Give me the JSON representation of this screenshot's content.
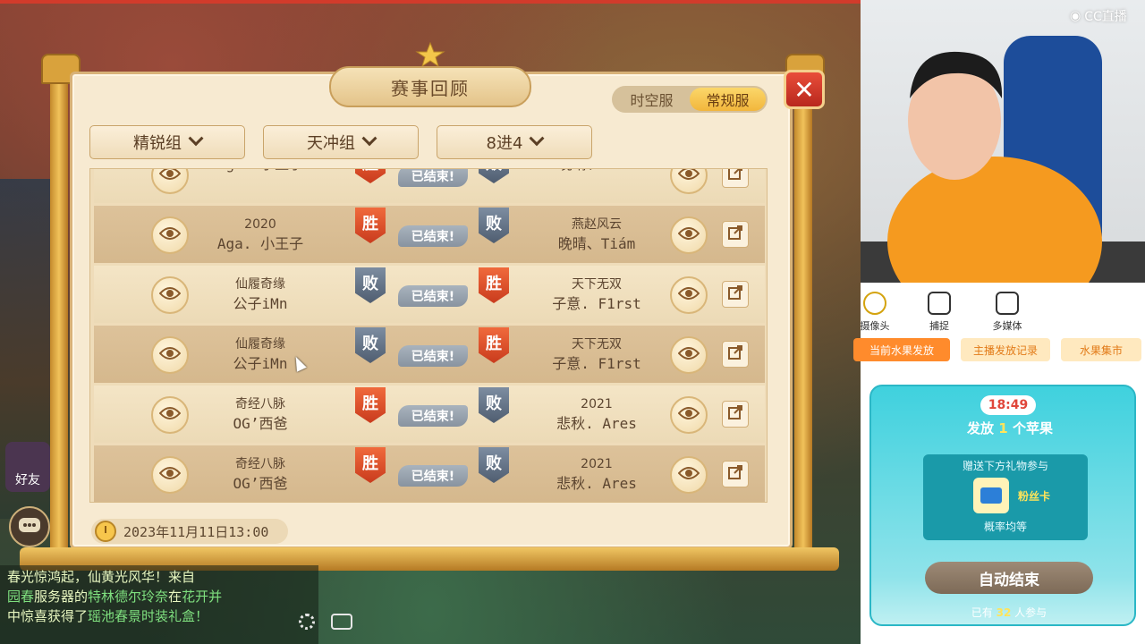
{
  "game": {
    "modal": {
      "title": "赛事回顾",
      "server_tabs": [
        {
          "label": "时空服",
          "active": false
        },
        {
          "label": "常规服",
          "active": true
        }
      ],
      "close_icon": "close-icon",
      "filters": [
        {
          "label": "精锐组"
        },
        {
          "label": "天冲组"
        },
        {
          "label": "8进4"
        }
      ],
      "matches": [
        {
          "left_l1": "",
          "left_l2": "Aga. 小王子",
          "left_result": "胜",
          "right_result": "败",
          "status": "已结束!",
          "right_l1": "",
          "right_l2": "晚晴、Tiám"
        },
        {
          "left_l1": "2020",
          "left_l2": "Aga. 小王子",
          "left_result": "胜",
          "right_result": "败",
          "status": "已结束!",
          "right_l1": "燕赵风云",
          "right_l2": "晚晴、Tiám"
        },
        {
          "left_l1": "仙履奇缘",
          "left_l2": "公子iMn",
          "left_result": "败",
          "right_result": "胜",
          "status": "已结束!",
          "right_l1": "天下无双",
          "right_l2": "子意. F1rst"
        },
        {
          "left_l1": "仙履奇缘",
          "left_l2": "公子iMn",
          "left_result": "败",
          "right_result": "胜",
          "status": "已结束!",
          "right_l1": "天下无双",
          "right_l2": "子意. F1rst"
        },
        {
          "left_l1": "奇经八脉",
          "left_l2": "OG’西爸",
          "left_result": "胜",
          "right_result": "败",
          "status": "已结束!",
          "right_l1": "2021",
          "right_l2": "悲秋. Ares"
        },
        {
          "left_l1": "奇经八脉",
          "left_l2": "OG’西爸",
          "left_result": "胜",
          "right_result": "败",
          "status": "已结束!",
          "right_l1": "2021",
          "right_l2": "悲秋. Ares"
        }
      ],
      "date": "2023年11月11日13:00"
    },
    "friend_label": "好友",
    "chat": {
      "line1": "春光惊鸿起，仙黄光风华！来自",
      "line2a": "园春",
      "line2b": "服务器的",
      "line2c": "特林德尔玲奈",
      "line2d": "在",
      "line2e": "花开并",
      "line3a": "中惊喜获得了",
      "line3b": "瑶池春景时装礼盒！"
    }
  },
  "stream": {
    "logo": "CC直播",
    "tools": [
      {
        "label": "摄像头",
        "icon": "camera-icon"
      },
      {
        "label": "捕捉",
        "icon": "capture-icon"
      },
      {
        "label": "多媒体",
        "icon": "media-icon"
      }
    ],
    "tabs": [
      {
        "label": "当前水果发放"
      },
      {
        "label": "主播发放记录"
      },
      {
        "label": "水果集市"
      }
    ],
    "gift": {
      "time": "18:49",
      "give_prefix": "发放",
      "give_count": "1",
      "give_suffix": "个苹果",
      "box_title": "赠送下方礼物参与",
      "gift_name": "粉丝卡",
      "probability": "概率均等",
      "auto_end": "自动结束",
      "joined_prefix": "已有",
      "joined_count": "32",
      "joined_suffix": "人参与"
    }
  }
}
